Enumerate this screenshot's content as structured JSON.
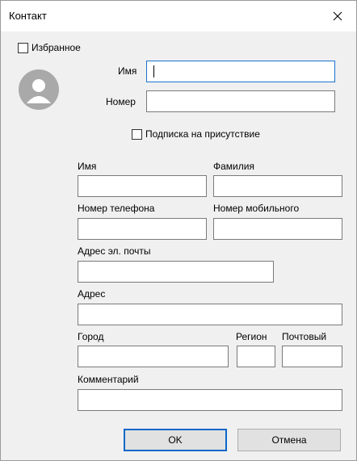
{
  "window": {
    "title": "Контакт"
  },
  "favorite": {
    "label": "Избранное",
    "checked": false
  },
  "top": {
    "name_label": "Имя",
    "number_label": "Номер",
    "name_value": "",
    "number_value": ""
  },
  "presence": {
    "label": "Подписка на присутствие",
    "checked": false
  },
  "form": {
    "first_name_label": "Имя",
    "last_name_label": "Фамилия",
    "phone_label": "Номер телефона",
    "mobile_label": "Номер мобильного",
    "email_label": "Адрес эл. почты",
    "address_label": "Адрес",
    "city_label": "Город",
    "region_label": "Регион",
    "postal_label": "Почтовый",
    "comment_label": "Комментарий"
  },
  "buttons": {
    "ok": "OK",
    "cancel": "Отмена"
  },
  "icons": {
    "close": "close-icon",
    "avatar": "user-avatar-icon"
  }
}
